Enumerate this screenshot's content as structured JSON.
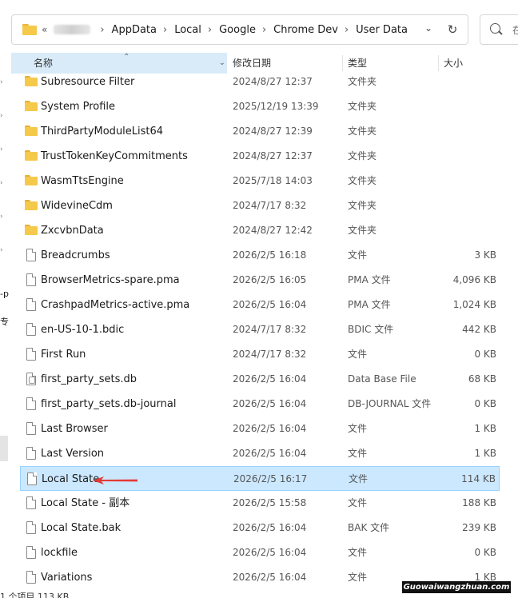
{
  "address_bar": {
    "prefix": "«",
    "crumbs": [
      "AppData",
      "Local",
      "Google",
      "Chrome Dev",
      "User Data"
    ],
    "dropdown_icon": "chevron-down-icon",
    "refresh_icon": "refresh-icon"
  },
  "search": {
    "placeholder": "在"
  },
  "left_fragments": [
    "-p",
    "专"
  ],
  "columns": {
    "name": "名称",
    "date": "修改日期",
    "type": "类型",
    "size": "大小"
  },
  "rows": [
    {
      "name": "Subresource Filter",
      "date": "2024/8/27 12:37",
      "type": "文件夹",
      "size": "",
      "kind": "folder"
    },
    {
      "name": "System Profile",
      "date": "2025/12/19 13:39",
      "type": "文件夹",
      "size": "",
      "kind": "folder"
    },
    {
      "name": "ThirdPartyModuleList64",
      "date": "2024/8/27 12:39",
      "type": "文件夹",
      "size": "",
      "kind": "folder"
    },
    {
      "name": "TrustTokenKeyCommitments",
      "date": "2024/8/27 12:37",
      "type": "文件夹",
      "size": "",
      "kind": "folder"
    },
    {
      "name": "WasmTtsEngine",
      "date": "2025/7/18 14:03",
      "type": "文件夹",
      "size": "",
      "kind": "folder"
    },
    {
      "name": "WidevineCdm",
      "date": "2024/7/17 8:32",
      "type": "文件夹",
      "size": "",
      "kind": "folder"
    },
    {
      "name": "ZxcvbnData",
      "date": "2024/8/27 12:42",
      "type": "文件夹",
      "size": "",
      "kind": "folder"
    },
    {
      "name": "Breadcrumbs",
      "date": "2026/2/5 16:18",
      "type": "文件",
      "size": "3 KB",
      "kind": "file"
    },
    {
      "name": "BrowserMetrics-spare.pma",
      "date": "2026/2/5 16:05",
      "type": "PMA 文件",
      "size": "4,096 KB",
      "kind": "file"
    },
    {
      "name": "CrashpadMetrics-active.pma",
      "date": "2026/2/5 16:04",
      "type": "PMA 文件",
      "size": "1,024 KB",
      "kind": "file"
    },
    {
      "name": "en-US-10-1.bdic",
      "date": "2024/7/17 8:32",
      "type": "BDIC 文件",
      "size": "442 KB",
      "kind": "file"
    },
    {
      "name": "First Run",
      "date": "2024/7/17 8:32",
      "type": "文件",
      "size": "0 KB",
      "kind": "file"
    },
    {
      "name": "first_party_sets.db",
      "date": "2026/2/5 16:04",
      "type": "Data Base File",
      "size": "68 KB",
      "kind": "db"
    },
    {
      "name": "first_party_sets.db-journal",
      "date": "2026/2/5 16:04",
      "type": "DB-JOURNAL 文件",
      "size": "0 KB",
      "kind": "file"
    },
    {
      "name": "Last Browser",
      "date": "2026/2/5 16:04",
      "type": "文件",
      "size": "1 KB",
      "kind": "file"
    },
    {
      "name": "Last Version",
      "date": "2026/2/5 16:04",
      "type": "文件",
      "size": "1 KB",
      "kind": "file"
    },
    {
      "name": "Local State",
      "date": "2026/2/5 16:17",
      "type": "文件",
      "size": "114 KB",
      "kind": "file",
      "selected": true
    },
    {
      "name": "Local State - 副本",
      "date": "2026/2/5 15:58",
      "type": "文件",
      "size": "188 KB",
      "kind": "file"
    },
    {
      "name": "Local State.bak",
      "date": "2026/2/5 16:04",
      "type": "BAK 文件",
      "size": "239 KB",
      "kind": "file"
    },
    {
      "name": "lockfile",
      "date": "2026/2/5 16:04",
      "type": "文件",
      "size": "0 KB",
      "kind": "file"
    },
    {
      "name": "Variations",
      "date": "2026/2/5 16:04",
      "type": "文件",
      "size": "1 KB",
      "kind": "file"
    }
  ],
  "status": {
    "text": "1 个项目   113 KB"
  },
  "watermark": "Guowaiwangzhuan.com",
  "colors": {
    "selection": "#cce8ff",
    "selection_border": "#99d1ff",
    "header_active": "#d9ebf9",
    "folder": "#f5c94a",
    "arrow": "#e53935"
  }
}
